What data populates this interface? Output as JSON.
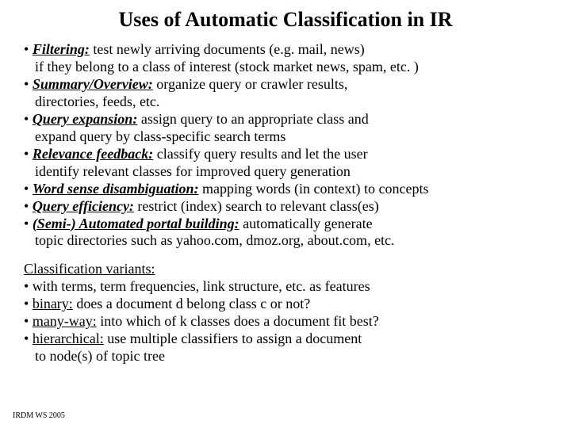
{
  "title": "Uses of Automatic Classification in IR",
  "uses": [
    {
      "term": "Filtering:",
      "rest": " test newly arriving documents (e.g. mail, news)",
      "cont": "if they belong to a class of interest (stock market news, spam, etc. )"
    },
    {
      "term": "Summary/Overview:",
      "rest": " organize query or crawler results,",
      "cont": "directories, feeds, etc."
    },
    {
      "term": "Query expansion:",
      "rest": " assign query to an appropriate class and",
      "cont": "expand query by class-specific search terms"
    },
    {
      "term": "Relevance feedback:",
      "rest": " classify query results and let the user",
      "cont": "identify relevant classes for improved query generation"
    },
    {
      "term": "Word sense disambiguation:",
      "rest": " mapping words (in context) to concepts",
      "cont": ""
    },
    {
      "term": "Query efficiency:",
      "rest": " restrict (index) search to relevant class(es)",
      "cont": ""
    },
    {
      "term": "(Semi-) Automated portal building:",
      "rest": " automatically generate",
      "cont": "topic directories such as yahoo.com, dmoz.org, about.com, etc."
    }
  ],
  "variants_heading": "Classification variants:",
  "variants": [
    {
      "prefix": "• with terms, term frequencies, link structure, etc. as features",
      "term": "",
      "rest": ""
    },
    {
      "prefix": "• ",
      "term": "binary:",
      "rest": " does a document d belong class c or not?"
    },
    {
      "prefix": "• ",
      "term": "many-way:",
      "rest": " into which of k classes does a document fit best?"
    },
    {
      "prefix": "• ",
      "term": "hierarchical:",
      "rest": " use multiple classifiers to assign a document"
    }
  ],
  "variants_cont": "to node(s) of topic tree",
  "footer": "IRDM  WS 2005"
}
